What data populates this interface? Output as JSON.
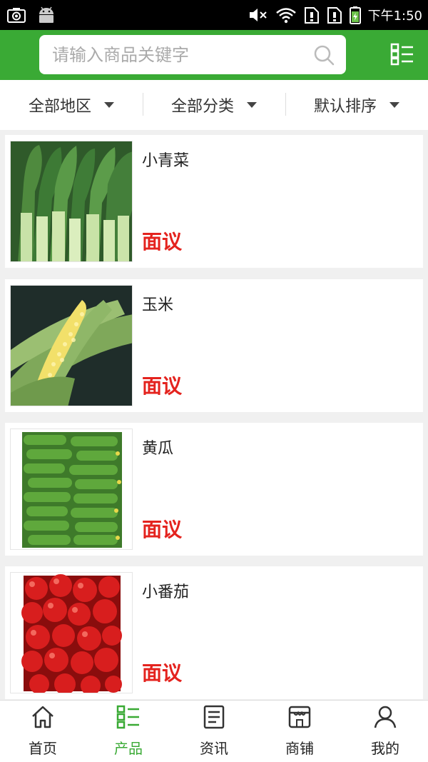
{
  "status_bar": {
    "time": "下午1:50",
    "icons": [
      "camera-icon",
      "android-icon",
      "mute-icon",
      "wifi-icon",
      "sim1-icon",
      "sim2-icon",
      "battery-icon"
    ]
  },
  "search": {
    "placeholder": "请输入商品关键字",
    "value": ""
  },
  "filters": [
    {
      "label": "全部地区"
    },
    {
      "label": "全部分类"
    },
    {
      "label": "默认排序"
    }
  ],
  "products": [
    {
      "name": "小青菜",
      "price": "面议",
      "image": "bok-choy"
    },
    {
      "name": "玉米",
      "price": "面议",
      "image": "corn"
    },
    {
      "name": "黄瓜",
      "price": "面议",
      "image": "cucumber"
    },
    {
      "name": "小番茄",
      "price": "面议",
      "image": "tomato"
    }
  ],
  "bottom_nav": [
    {
      "label": "首页",
      "icon": "home-icon",
      "active": false
    },
    {
      "label": "产品",
      "icon": "products-icon",
      "active": true
    },
    {
      "label": "资讯",
      "icon": "news-icon",
      "active": false
    },
    {
      "label": "商铺",
      "icon": "shop-icon",
      "active": false
    },
    {
      "label": "我的",
      "icon": "user-icon",
      "active": false
    }
  ],
  "colors": {
    "brand_green": "#3aaa35",
    "price_red": "#e4231e"
  }
}
